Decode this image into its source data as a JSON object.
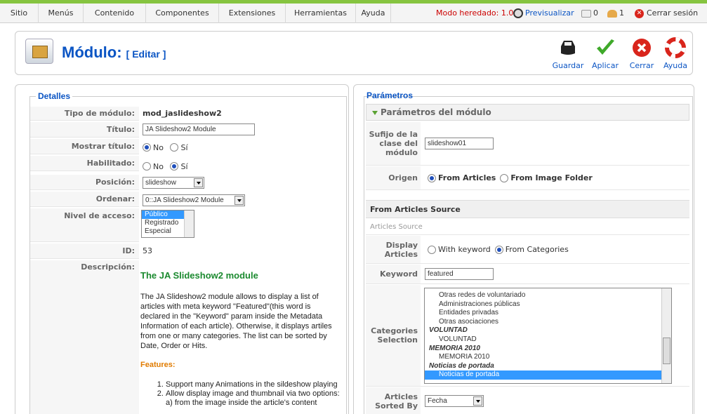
{
  "menu": {
    "items": [
      "Sitio",
      "Menús",
      "Contenido",
      "Componentes",
      "Extensiones",
      "Herramientas",
      "Ayuda"
    ],
    "legacy_mode": "Modo heredado: 1.0",
    "preview": "Previsualizar",
    "messages_count": "0",
    "users_count": "1",
    "logout": "Cerrar sesión"
  },
  "header": {
    "title": "Módulo:",
    "subtitle": "[ Editar ]"
  },
  "toolbar": {
    "save": "Guardar",
    "apply": "Aplicar",
    "close": "Cerrar",
    "help": "Ayuda"
  },
  "details": {
    "legend": "Detalles",
    "module_type_label": "Tipo de módulo:",
    "module_type_value": "mod_jaslideshow2",
    "title_label": "Título:",
    "title_value": "JA Slideshow2 Module",
    "show_title_label": "Mostrar título:",
    "show_title_no": "No",
    "show_title_yes": "Sí",
    "enabled_label": "Habilitado:",
    "enabled_no": "No",
    "enabled_yes": "Sí",
    "position_label": "Posición:",
    "position_value": "slideshow",
    "order_label": "Ordenar:",
    "order_value": "0::JA Slideshow2 Module",
    "access_label": "Nivel de acceso:",
    "access_options": [
      "Público",
      "Registrado",
      "Especial"
    ],
    "id_label": "ID:",
    "id_value": "53",
    "description_label": "Descripción:",
    "description_title": "The JA Slideshow2 module",
    "description_text": "The JA Slideshow2 module allows to display a list of articles with meta keyword \"Featured\"(this word is declared in the \"Keyword\" param inside the Metadata Information of each article). Otherwise, it displays artiles from one or many categories. The list can be sorted by Date, Order or Hits.",
    "features_title": "Features:",
    "feature_1": "Support many Animations in the sildeshow playing",
    "feature_2": "Allow display image and thumbnail via two options:",
    "feature_2a": "a) from the image inside the article's content"
  },
  "params": {
    "legend": "Parámetros",
    "panel_title": "Parámetros del módulo",
    "suffix_label": "Sufijo de la clase del módulo",
    "suffix_value": "slideshow01",
    "origin_label": "Origen",
    "origin_articles": "From Articles",
    "origin_folder": "From Image Folder",
    "section_title": "From Articles Source",
    "section_sub": "Articles Source",
    "display_label": "Display Articles",
    "display_keyword": "With keyword",
    "display_categories": "From Categories",
    "keyword_label": "Keyword",
    "keyword_value": "featured",
    "categories_label": "Categories Selection",
    "categories": [
      {
        "label": "Otras redes de voluntariado",
        "type": "item"
      },
      {
        "label": "Administraciones públicas",
        "type": "item"
      },
      {
        "label": "Entidades privadas",
        "type": "item"
      },
      {
        "label": "Otras asociaciones",
        "type": "item"
      },
      {
        "label": "VOLUNTAD",
        "type": "group"
      },
      {
        "label": "VOLUNTAD",
        "type": "item"
      },
      {
        "label": "MEMORIA 2010",
        "type": "group"
      },
      {
        "label": "MEMORIA 2010",
        "type": "item"
      },
      {
        "label": "Noticias de portada",
        "type": "group"
      },
      {
        "label": "Noticias de portada",
        "type": "selected"
      }
    ],
    "sorted_label": "Articles Sorted By",
    "sorted_value": "Fecha"
  },
  "colors": {
    "accent": "#0B55C4",
    "green": "#86c440",
    "legacy": "#cc0000",
    "select_bg": "#3399ff"
  }
}
